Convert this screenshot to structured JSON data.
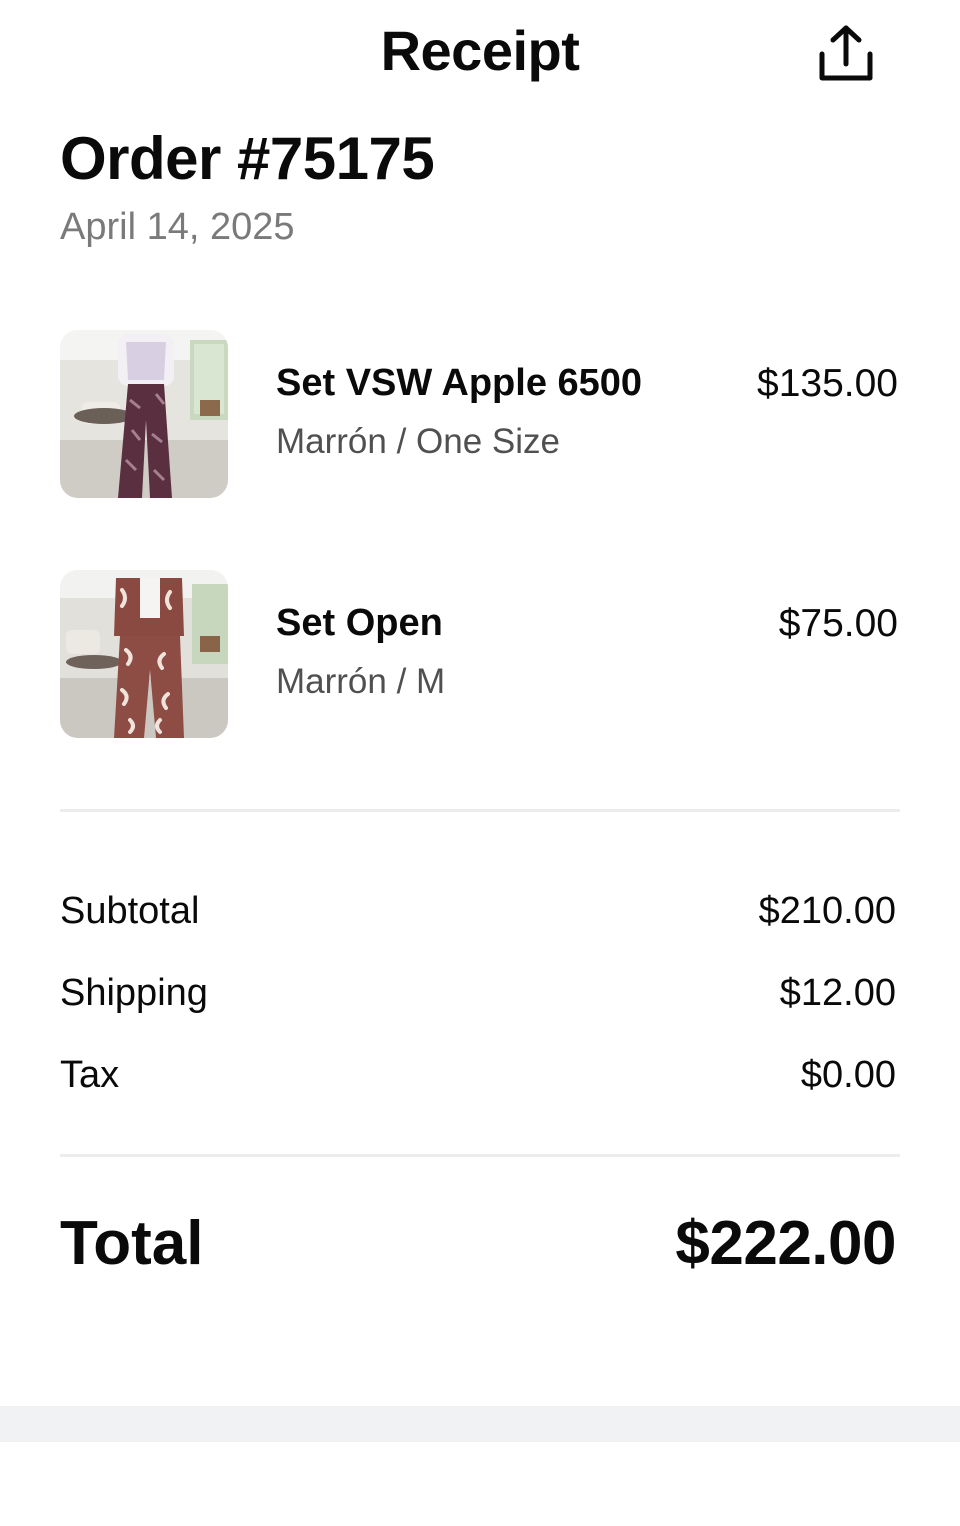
{
  "header": {
    "title": "Receipt",
    "share_icon": "share-upload-icon"
  },
  "order": {
    "title": "Order #75175",
    "date": "April 14, 2025"
  },
  "items": [
    {
      "name": "Set VSW Apple 6500",
      "variant": "Marrón / One Size",
      "price": "$135.00",
      "image": "photo of woman in white top and brown zebra-print flared pants"
    },
    {
      "name": "Set Open",
      "variant": "Marrón / M",
      "price": "$75.00",
      "image": "photo of woman in brown and white printed open shirt and pants set"
    }
  ],
  "summary": {
    "subtotal_label": "Subtotal",
    "subtotal_value": "$210.00",
    "shipping_label": "Shipping",
    "shipping_value": "$12.00",
    "tax_label": "Tax",
    "tax_value": "$0.00"
  },
  "total": {
    "label": "Total",
    "value": "$222.00"
  },
  "colors": {
    "text": "#0a0a0a",
    "muted": "#7a7a7a",
    "variant": "#505050",
    "divider": "#ececec",
    "band": "#f1f2f4"
  }
}
